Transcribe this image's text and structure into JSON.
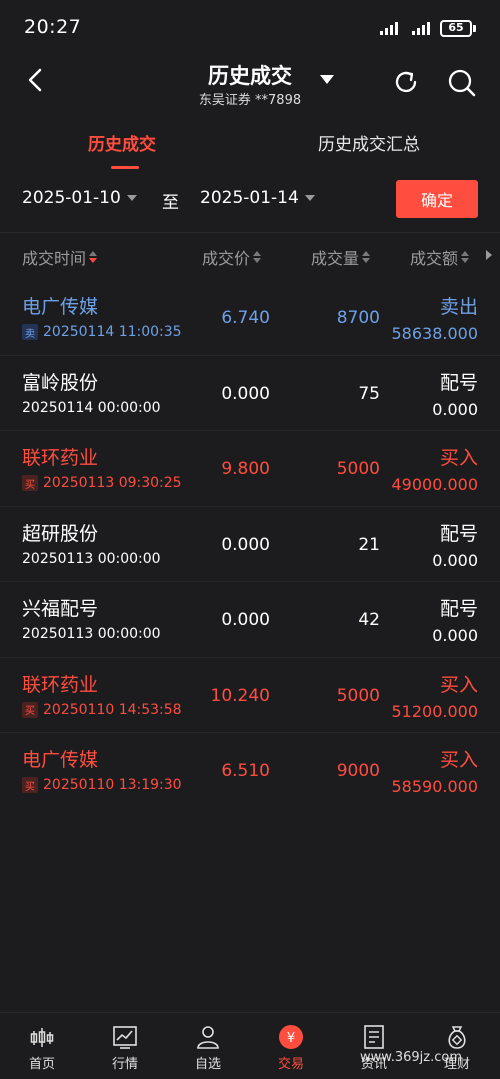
{
  "status_bar": {
    "time": "20:27",
    "battery": "65"
  },
  "header": {
    "title": "历史成交",
    "subtitle": "东吴证券 **7898"
  },
  "tabs": [
    {
      "label": "历史成交",
      "active": true
    },
    {
      "label": "历史成交汇总",
      "active": false
    }
  ],
  "date_filter": {
    "from": "2025-01-10",
    "separator": "至",
    "to": "2025-01-14",
    "confirm_label": "确定"
  },
  "columns": {
    "time": "成交时间",
    "price": "成交价",
    "qty": "成交量",
    "amount": "成交额"
  },
  "trades": [
    {
      "name": "电广传媒",
      "tag": "卖",
      "datetime": "20250114 11:00:35",
      "price": "6.740",
      "qty": "8700",
      "action": "卖出",
      "amount": "58638.000",
      "color": "blue"
    },
    {
      "name": "富岭股份",
      "tag": "",
      "datetime": "20250114 00:00:00",
      "price": "0.000",
      "qty": "75",
      "action": "配号",
      "amount": "0.000",
      "color": "white"
    },
    {
      "name": "联环药业",
      "tag": "买",
      "datetime": "20250113 09:30:25",
      "price": "9.800",
      "qty": "5000",
      "action": "买入",
      "amount": "49000.000",
      "color": "red"
    },
    {
      "name": "超研股份",
      "tag": "",
      "datetime": "20250113 00:00:00",
      "price": "0.000",
      "qty": "21",
      "action": "配号",
      "amount": "0.000",
      "color": "white"
    },
    {
      "name": "兴福配号",
      "tag": "",
      "datetime": "20250113 00:00:00",
      "price": "0.000",
      "qty": "42",
      "action": "配号",
      "amount": "0.000",
      "color": "white"
    },
    {
      "name": "联环药业",
      "tag": "买",
      "datetime": "20250110 14:53:58",
      "price": "10.240",
      "qty": "5000",
      "action": "买入",
      "amount": "51200.000",
      "color": "red"
    },
    {
      "name": "电广传媒",
      "tag": "买",
      "datetime": "20250110 13:19:30",
      "price": "6.510",
      "qty": "9000",
      "action": "买入",
      "amount": "58590.000",
      "color": "red"
    }
  ],
  "bottom_nav": [
    {
      "label": "首页",
      "icon": "candlestick-icon"
    },
    {
      "label": "行情",
      "icon": "chart-icon"
    },
    {
      "label": "自选",
      "icon": "person-icon"
    },
    {
      "label": "交易",
      "icon": "yuan-icon",
      "active": true
    },
    {
      "label": "资讯",
      "icon": "document-icon"
    },
    {
      "label": "理财",
      "icon": "money-bag-icon"
    }
  ],
  "watermark": "www.369jz.com",
  "colors": {
    "accent": "#ff4d3f",
    "sell_blue": "#6ea0e6",
    "background": "#1c1c1e"
  }
}
